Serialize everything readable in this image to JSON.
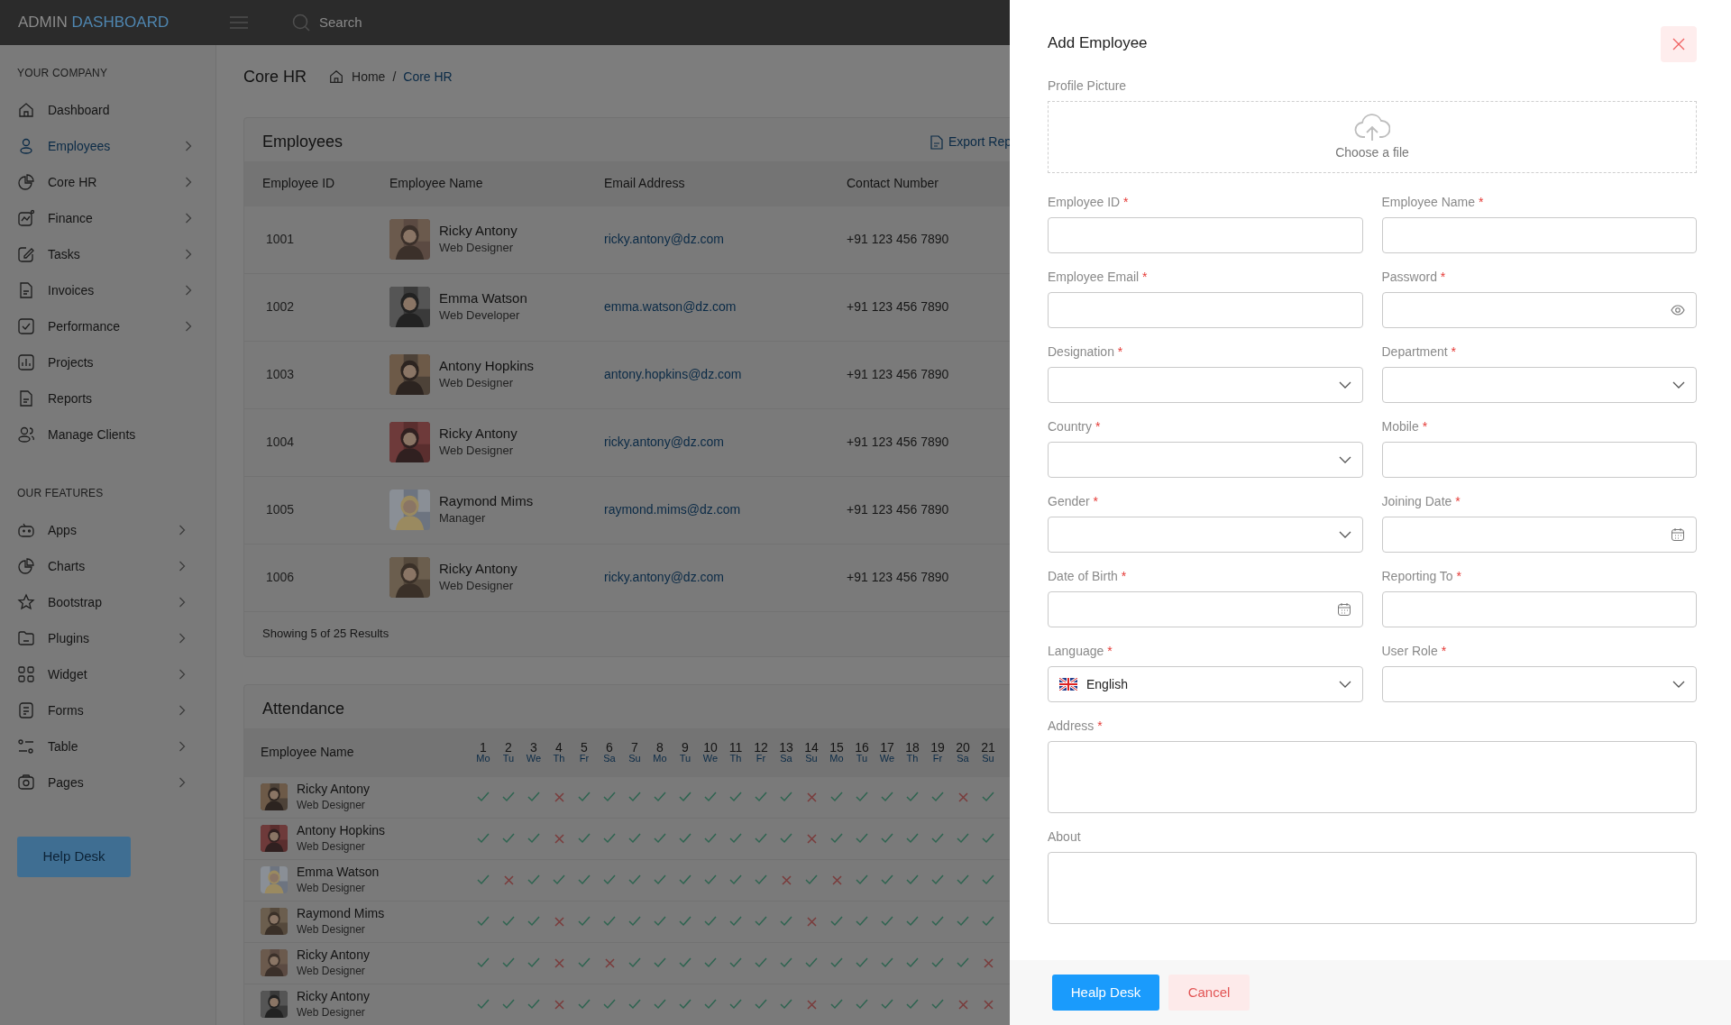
{
  "header": {
    "brand_main": "ADMIN",
    "brand_accent": "DASHBOARD",
    "search_placeholder": "Search"
  },
  "sidebar": {
    "sections": [
      {
        "title": "YOUR COMPANY",
        "items": [
          {
            "label": "Dashboard",
            "selected": false,
            "has_submenu": false
          },
          {
            "label": "Employees",
            "selected": true,
            "has_submenu": true
          },
          {
            "label": "Core HR",
            "selected": false,
            "has_submenu": true
          },
          {
            "label": "Finance",
            "selected": false,
            "has_submenu": true
          },
          {
            "label": "Tasks",
            "selected": false,
            "has_submenu": true
          },
          {
            "label": "Invoices",
            "selected": false,
            "has_submenu": true
          },
          {
            "label": "Performance",
            "selected": false,
            "has_submenu": true
          },
          {
            "label": "Projects",
            "selected": false,
            "has_submenu": false
          },
          {
            "label": "Reports",
            "selected": false,
            "has_submenu": false
          },
          {
            "label": "Manage Clients",
            "selected": false,
            "has_submenu": false
          }
        ]
      },
      {
        "title": "OUR FEATURES",
        "items": [
          {
            "label": "Apps",
            "selected": false,
            "has_submenu": true
          },
          {
            "label": "Charts",
            "selected": false,
            "has_submenu": true
          },
          {
            "label": "Bootstrap",
            "selected": false,
            "has_submenu": true
          },
          {
            "label": "Plugins",
            "selected": false,
            "has_submenu": true
          },
          {
            "label": "Widget",
            "selected": false,
            "has_submenu": true
          },
          {
            "label": "Forms",
            "selected": false,
            "has_submenu": true
          },
          {
            "label": "Table",
            "selected": false,
            "has_submenu": true
          },
          {
            "label": "Pages",
            "selected": false,
            "has_submenu": true
          }
        ]
      }
    ],
    "help_button": "Help Desk"
  },
  "page_header": {
    "title": "Core HR",
    "separator": "/",
    "breadcrumb": [
      {
        "label": "Home",
        "selected": false
      },
      {
        "label": "Core HR",
        "selected": true
      }
    ]
  },
  "employees": {
    "title": "Employees",
    "export": "Export Rep",
    "columns": [
      "Employee ID",
      "Employee Name",
      "Email Address",
      "Contact Number"
    ],
    "rows": [
      {
        "id": "1001",
        "name": "Ricky Antony",
        "role": "Web Designer",
        "email": "ricky.antony@dz.com",
        "phone": "+91 123 456 7890"
      },
      {
        "id": "1002",
        "name": "Emma Watson",
        "role": "Web Developer",
        "email": "emma.watson@dz.com",
        "phone": "+91 123 456 7890"
      },
      {
        "id": "1003",
        "name": "Antony Hopkins",
        "role": "Web Designer",
        "email": "antony.hopkins@dz.com",
        "phone": "+91 123 456 7890"
      },
      {
        "id": "1004",
        "name": "Ricky Antony",
        "role": "Web Designer",
        "email": "ricky.antony@dz.com",
        "phone": "+91 123 456 7890"
      },
      {
        "id": "1005",
        "name": "Raymond Mims",
        "role": "Manager",
        "email": "raymond.mims@dz.com",
        "phone": "+91 123 456 7890"
      },
      {
        "id": "1006",
        "name": "Ricky Antony",
        "role": "Web Designer",
        "email": "ricky.antony@dz.com",
        "phone": "+91 123 456 7890"
      }
    ],
    "footer": "Showing 5 of 25 Results"
  },
  "attendance": {
    "title": "Attendance",
    "name_column": "Employee Name",
    "days": [
      {
        "day": "1",
        "weekday": "Mo"
      },
      {
        "day": "2",
        "weekday": "Tu"
      },
      {
        "day": "3",
        "weekday": "We"
      },
      {
        "day": "4",
        "weekday": "Th"
      },
      {
        "day": "5",
        "weekday": "Fr"
      },
      {
        "day": "6",
        "weekday": "Sa"
      },
      {
        "day": "7",
        "weekday": "Su"
      },
      {
        "day": "8",
        "weekday": "Mo"
      },
      {
        "day": "9",
        "weekday": "Tu"
      },
      {
        "day": "10",
        "weekday": "We"
      },
      {
        "day": "11",
        "weekday": "Th"
      },
      {
        "day": "12",
        "weekday": "Fr"
      },
      {
        "day": "13",
        "weekday": "Sa"
      },
      {
        "day": "14",
        "weekday": "Su"
      },
      {
        "day": "15",
        "weekday": "Mo"
      },
      {
        "day": "16",
        "weekday": "Tu"
      },
      {
        "day": "17",
        "weekday": "We"
      },
      {
        "day": "18",
        "weekday": "Th"
      },
      {
        "day": "19",
        "weekday": "Fr"
      },
      {
        "day": "20",
        "weekday": "Sa"
      },
      {
        "day": "21",
        "weekday": "Su"
      }
    ],
    "rows": [
      {
        "name": "Ricky Antony",
        "role": "Web Designer",
        "present": [
          true,
          true,
          true,
          false,
          true,
          true,
          true,
          true,
          true,
          true,
          true,
          true,
          true,
          false,
          true,
          true,
          true,
          true,
          true,
          false,
          true
        ]
      },
      {
        "name": "Antony Hopkins",
        "role": "Web Designer",
        "present": [
          true,
          true,
          true,
          false,
          true,
          true,
          true,
          true,
          true,
          true,
          true,
          true,
          true,
          false,
          true,
          true,
          true,
          true,
          true,
          true,
          true
        ]
      },
      {
        "name": "Emma Watson",
        "role": "Web Designer",
        "present": [
          true,
          false,
          true,
          true,
          true,
          true,
          true,
          true,
          true,
          true,
          true,
          true,
          false,
          true,
          false,
          true,
          true,
          true,
          true,
          true,
          true
        ]
      },
      {
        "name": "Raymond Mims",
        "role": "Web Designer",
        "present": [
          true,
          true,
          true,
          false,
          true,
          true,
          true,
          true,
          true,
          true,
          true,
          true,
          true,
          false,
          true,
          true,
          true,
          true,
          true,
          true,
          true
        ]
      },
      {
        "name": "Ricky Antony",
        "role": "Web Designer",
        "present": [
          true,
          true,
          true,
          false,
          true,
          false,
          true,
          true,
          true,
          true,
          true,
          true,
          true,
          true,
          true,
          true,
          true,
          true,
          true,
          true,
          false
        ]
      },
      {
        "name": "Ricky Antony",
        "role": "Web Designer",
        "present": [
          true,
          true,
          true,
          false,
          true,
          true,
          true,
          true,
          true,
          true,
          true,
          true,
          true,
          false,
          true,
          true,
          true,
          true,
          true,
          false,
          false
        ]
      }
    ]
  },
  "panel": {
    "title": "Add Employee",
    "profile": {
      "label": "Profile Picture",
      "prompt": "Choose a file"
    },
    "fields": [
      {
        "label": "Employee ID",
        "required_mark": "*",
        "kind": "text"
      },
      {
        "label": "Employee Name",
        "required_mark": "*",
        "kind": "text"
      },
      {
        "label": "Employee Email",
        "required_mark": "*",
        "kind": "text"
      },
      {
        "label": "Password",
        "required_mark": "*",
        "kind": "password"
      },
      {
        "label": "Designation",
        "required_mark": "*",
        "kind": "select"
      },
      {
        "label": "Department",
        "required_mark": "*",
        "kind": "select"
      },
      {
        "label": "Country",
        "required_mark": "*",
        "kind": "select"
      },
      {
        "label": "Mobile",
        "required_mark": "*",
        "kind": "text"
      },
      {
        "label": "Gender",
        "required_mark": "*",
        "kind": "select"
      },
      {
        "label": "Joining Date",
        "required_mark": "*",
        "kind": "date"
      },
      {
        "label": "Date of Birth",
        "required_mark": "*",
        "kind": "date"
      },
      {
        "label": "Reporting To",
        "required_mark": "*",
        "kind": "text"
      },
      {
        "label": "Language",
        "required_mark": "*",
        "kind": "language",
        "value": "English"
      },
      {
        "label": "User Role",
        "required_mark": "*",
        "kind": "select"
      },
      {
        "label": "Address",
        "required_mark": "*",
        "kind": "textarea"
      },
      {
        "label": "About",
        "kind": "textarea"
      }
    ],
    "buttons": [
      {
        "label": "Healp Desk",
        "kind": "primary"
      },
      {
        "label": "Cancel",
        "kind": "cancel"
      }
    ]
  }
}
